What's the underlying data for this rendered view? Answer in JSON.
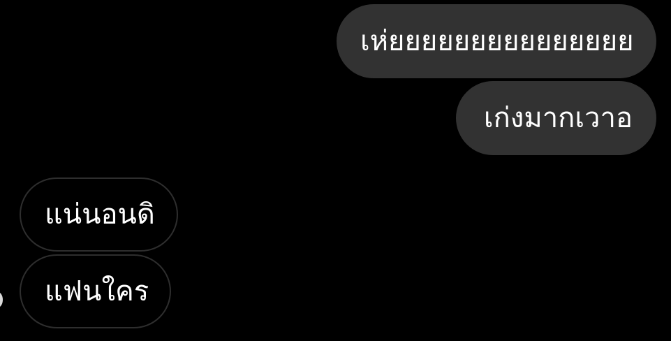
{
  "messages": [
    {
      "direction": "sent",
      "text": "เห่ยยยยยยยยยยยยยยย"
    },
    {
      "direction": "sent",
      "text": "เก่งมากเวาอ"
    },
    {
      "direction": "received",
      "text": "แน่นอนดิ"
    },
    {
      "direction": "received",
      "text": "แฟนใคร"
    }
  ],
  "colors": {
    "background": "#000000",
    "sent_bubble": "#323232",
    "received_border": "#2e2e2e",
    "text": "#ffffff"
  }
}
